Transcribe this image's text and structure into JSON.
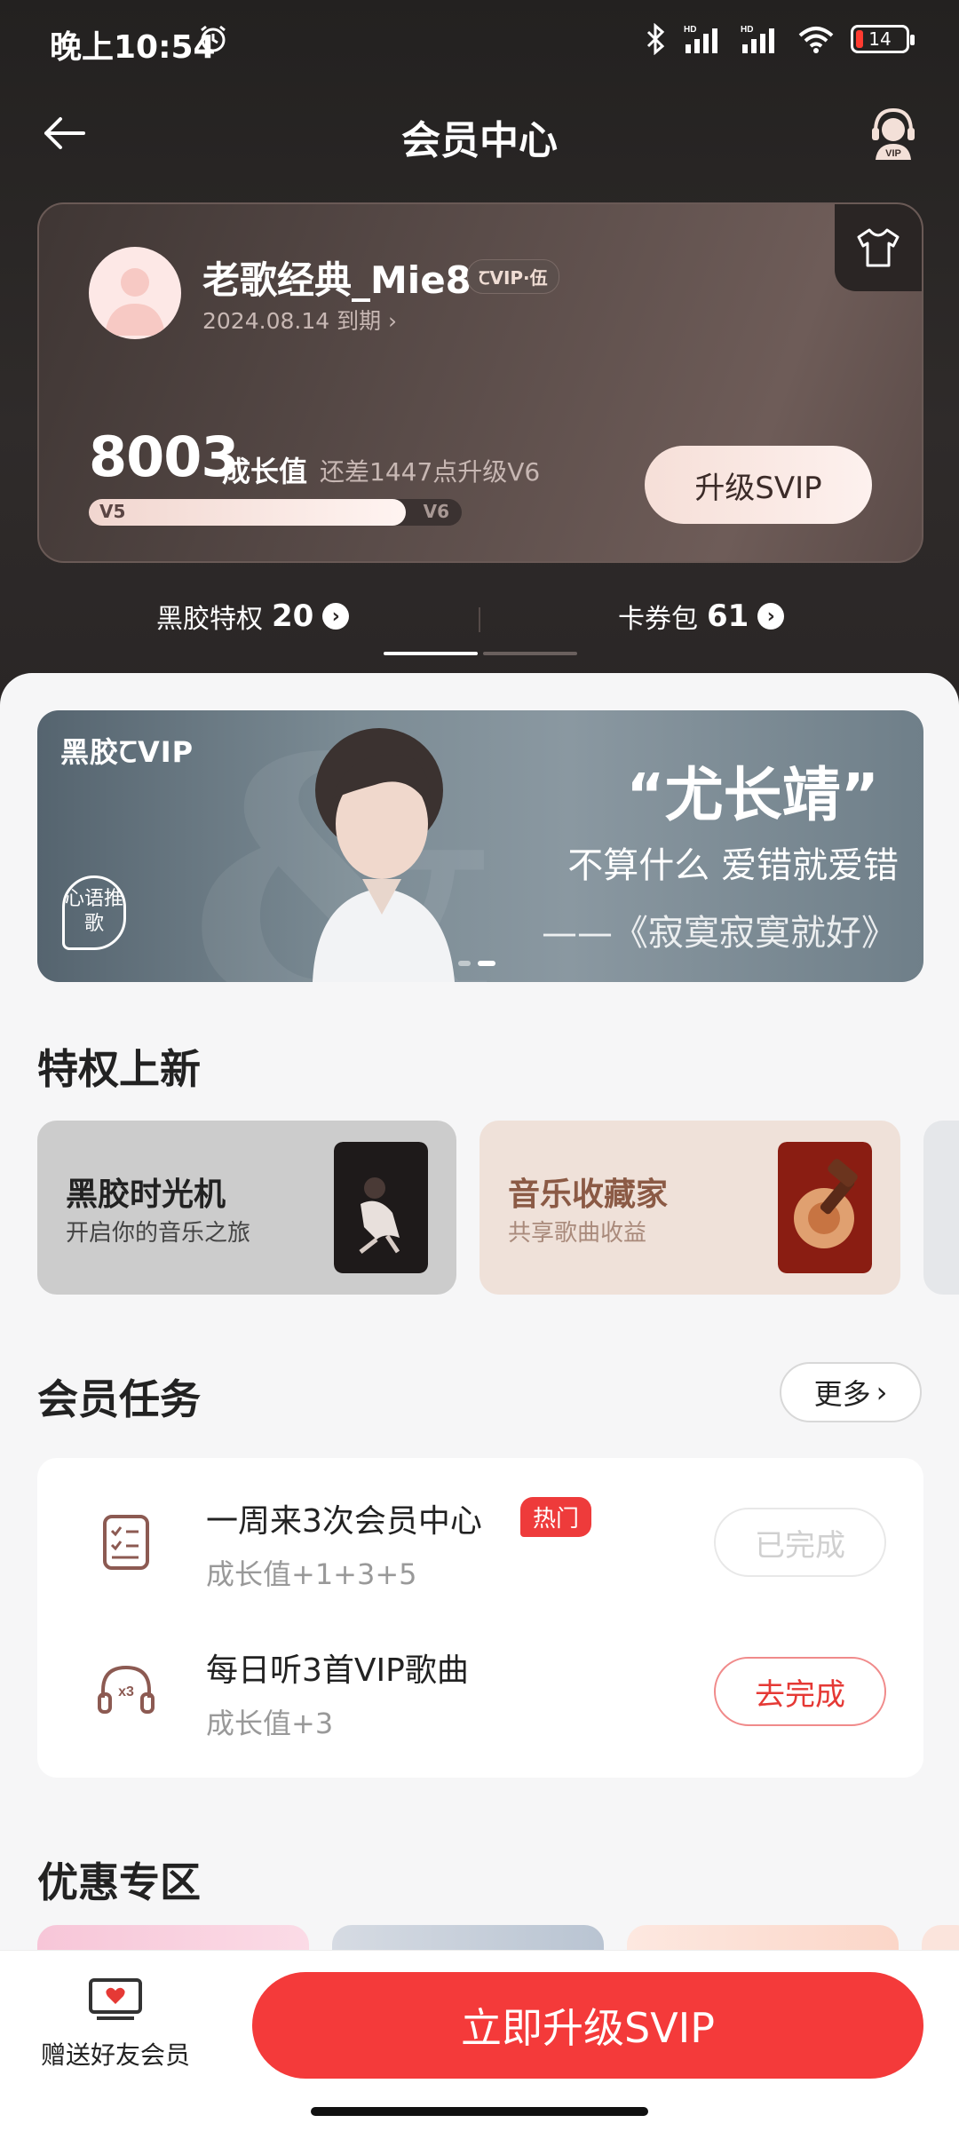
{
  "status_bar": {
    "time": "晚上10:54",
    "battery": "14",
    "network_labels": [
      "HD",
      "HD"
    ]
  },
  "nav": {
    "title": "会员中心",
    "service_badge": "VIP"
  },
  "member_card": {
    "username": "老歌经典_Mie8",
    "vip_badge": "ꞆVIP·伍",
    "expire": "2024.08.14 到期 ›",
    "growth_value": "8003",
    "growth_label": "成长值",
    "growth_gap": "还差1447点升级V6",
    "level_from": "V5",
    "level_to": "V6",
    "level_progress": 0.85,
    "upgrade_label": "升级SVIP"
  },
  "tabs": [
    {
      "label": "黑胶特权",
      "count": "20"
    },
    {
      "label": "卡券包",
      "count": "61"
    }
  ],
  "banner": {
    "brand": "黑胶ꞆVIP",
    "tag": "心语推歌",
    "artist": "“尤长靖”",
    "lyric": "不算什么 爱错就爱错",
    "song": "——《寂寞寂寞就好》"
  },
  "privileges": {
    "title": "特权上新",
    "items": [
      {
        "title": "黑胶时光机",
        "subtitle": "开启你的音乐之旅"
      },
      {
        "title": "音乐收藏家",
        "subtitle": "共享歌曲收益"
      }
    ]
  },
  "tasks": {
    "title": "会员任务",
    "more_label": "更多",
    "items": [
      {
        "title": "一周来3次会员中心",
        "badge": "热门",
        "reward": "成长值+1+3+5",
        "button": "已完成"
      },
      {
        "title": "每日听3首VIP歌曲",
        "reward": "成长值+3",
        "button": "去完成"
      }
    ]
  },
  "promo": {
    "title": "优惠专区"
  },
  "bottom": {
    "gift_label": "赠送好友会员",
    "cta_label": "立即升级SVIP"
  },
  "colors": {
    "accent_red": "#f43a3a",
    "header_bg": "#2b2727",
    "card_bg": "#5a4c49"
  }
}
